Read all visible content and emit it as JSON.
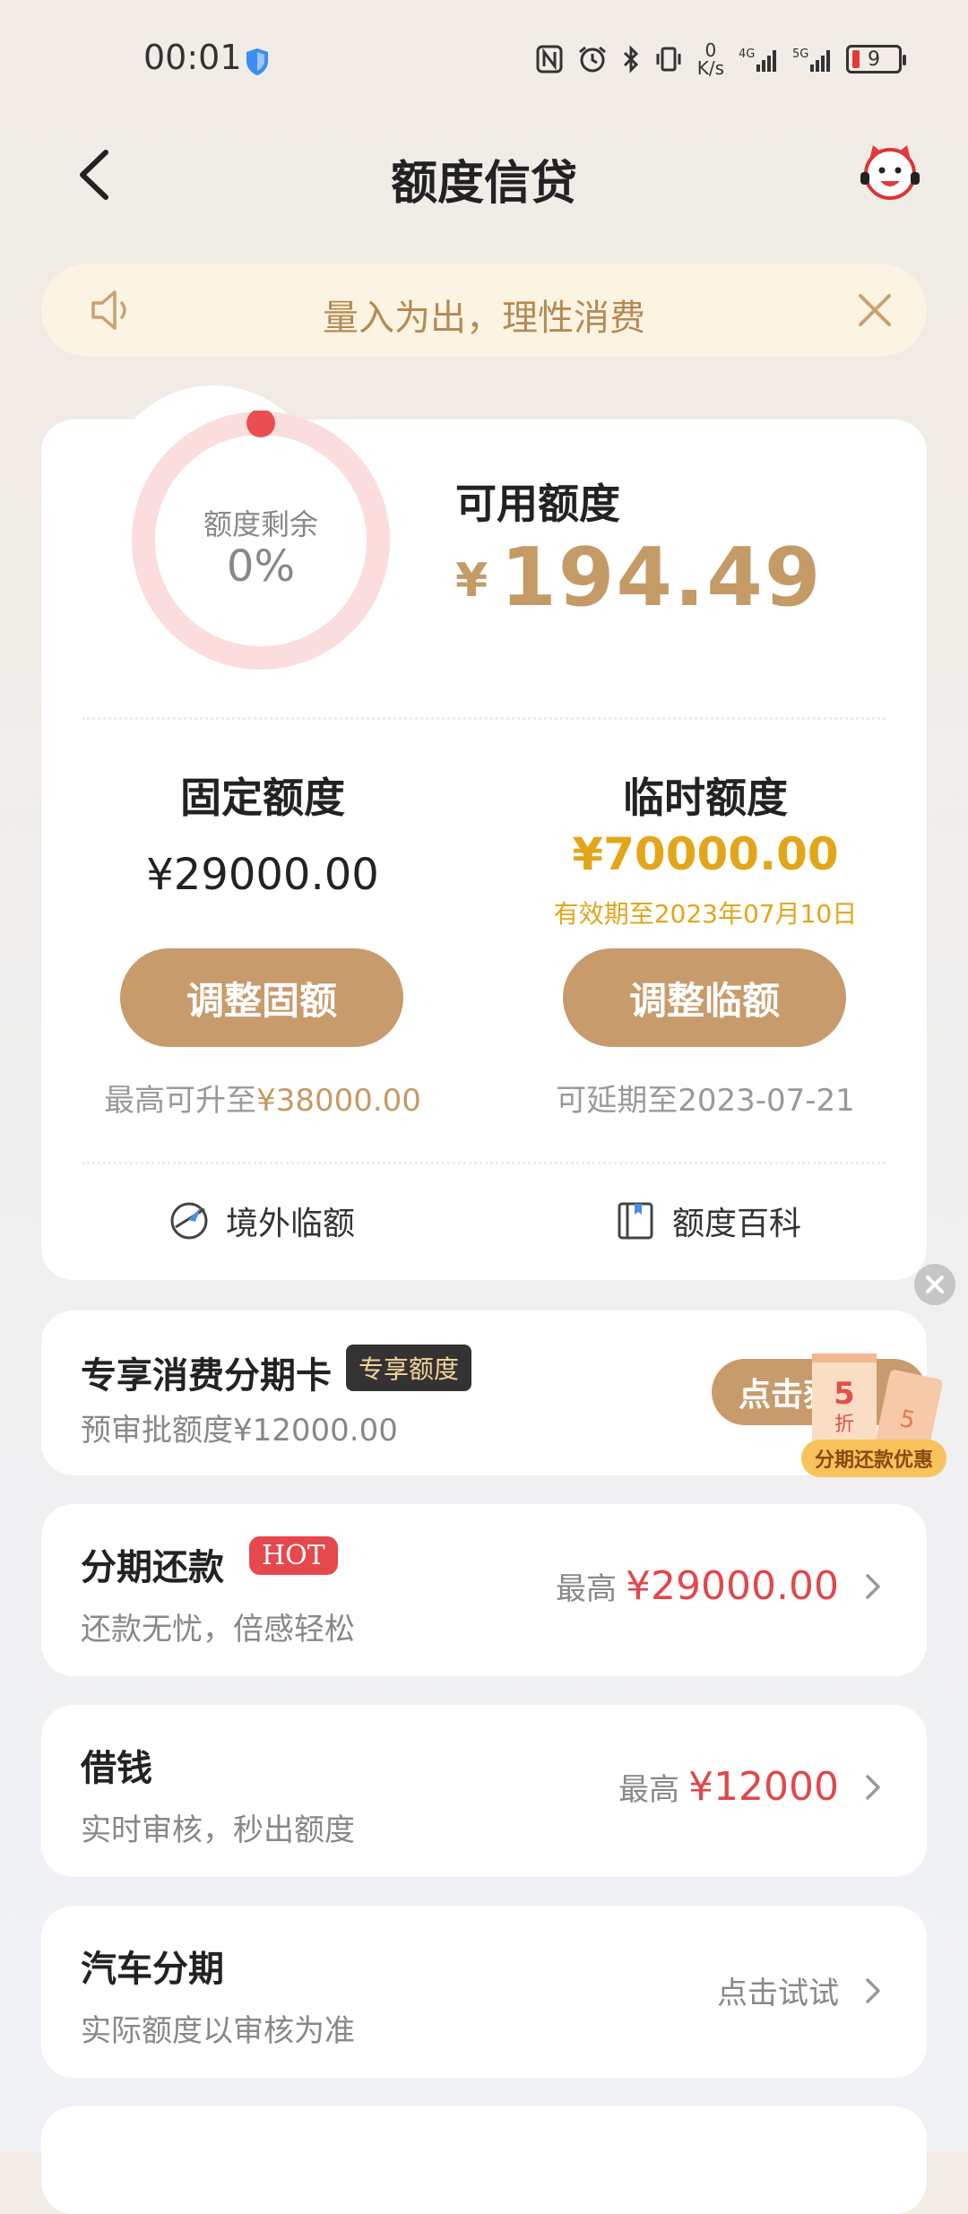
{
  "status_bar": {
    "time": "00:01",
    "net_speed_value": "0",
    "net_speed_unit": "K/s",
    "battery": "9"
  },
  "nav": {
    "title": "额度信贷"
  },
  "notice": {
    "text": "量入为出，理性消费"
  },
  "quota": {
    "ring_label": "额度剩余",
    "ring_value": "0%",
    "remaining_fraction": 0,
    "available_label": "可用额度",
    "currency_symbol": "¥",
    "available_amount": "194.49",
    "fixed": {
      "title": "固定额度",
      "amount": "¥29000.00",
      "button": "调整固额",
      "note_prefix": "最高可升至",
      "note_value": "¥38000.00"
    },
    "temp": {
      "title": "临时额度",
      "amount": "¥70000.00",
      "valid_until": "有效期至2023年07月10日",
      "button": "调整临额",
      "note": "可延期至2023-07-21"
    },
    "tools": [
      {
        "label": "境外临额",
        "icon": "globe-plane-icon"
      },
      {
        "label": "额度百科",
        "icon": "book-icon"
      }
    ]
  },
  "products": {
    "installment_card": {
      "title": "专享消费分期卡",
      "tag": "专享额度",
      "sub": "预审批额度¥12000.00",
      "button": "点击获",
      "promo_label": "分期还款优惠",
      "promo_number": "5",
      "promo_unit": "折"
    },
    "installment_repay": {
      "title": "分期还款",
      "tag": "HOT",
      "sub": "还款无忧，倍感轻松",
      "prefix": "最高",
      "amount": "¥29000.00"
    },
    "borrow": {
      "title": "借钱",
      "sub": "实时审核，秒出额度",
      "prefix": "最高",
      "amount": "¥12000"
    },
    "car": {
      "title": "汽车分期",
      "sub": "实际额度以审核为准",
      "action": "点击试试"
    }
  },
  "colors": {
    "accent": "#c89b6c",
    "gold": "#e3a61b",
    "red": "#e0484b",
    "ring": "#fbdddd",
    "ring_dot": "#e94f4f"
  }
}
